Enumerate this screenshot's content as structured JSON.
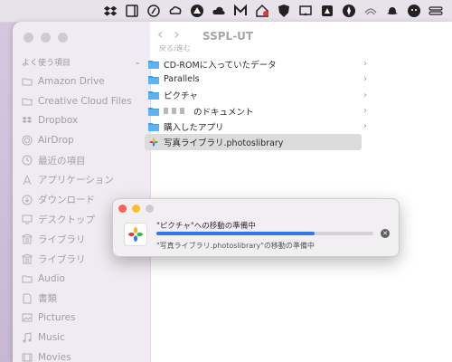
{
  "window": {
    "title": "SSPL-UT",
    "nav_label": "戻る/進む"
  },
  "sidebar": {
    "section_title": "よく使う項目",
    "items": [
      {
        "label": "Amazon Drive",
        "icon": "folder-icon"
      },
      {
        "label": "Creative Cloud Files",
        "icon": "folder-icon"
      },
      {
        "label": "Dropbox",
        "icon": "dropbox-icon"
      },
      {
        "label": "AirDrop",
        "icon": "airdrop-icon"
      },
      {
        "label": "最近の項目",
        "icon": "clock-icon"
      },
      {
        "label": "アプリケーション",
        "icon": "applications-icon"
      },
      {
        "label": "ダウンロード",
        "icon": "download-icon"
      },
      {
        "label": "デスクトップ",
        "icon": "desktop-icon"
      },
      {
        "label": "ライブラリ",
        "icon": "library-icon"
      },
      {
        "label": "ライブラリ",
        "icon": "library-icon"
      },
      {
        "label": "Audio",
        "icon": "folder-icon"
      },
      {
        "label": "書類",
        "icon": "document-icon"
      },
      {
        "label": "Pictures",
        "icon": "pictures-icon"
      },
      {
        "label": "Music",
        "icon": "music-icon"
      },
      {
        "label": "Movies",
        "icon": "movies-icon"
      }
    ]
  },
  "files": [
    {
      "name": "CD-ROMに入っていたデータ",
      "type": "folder"
    },
    {
      "name": "Parallels",
      "type": "folder"
    },
    {
      "name": "ピクチャ",
      "type": "folder"
    },
    {
      "name": "のドキュメント",
      "type": "folder"
    },
    {
      "name": "購入したアプリ",
      "type": "folder"
    },
    {
      "name": "写真ライブラリ.photoslibrary",
      "type": "photoslibrary"
    }
  ],
  "dialog": {
    "title": "\"ピクチャ\"への移動の準備中",
    "subtitle": "\"写真ライブラリ.photoslibrary\"の移動の準備中",
    "progress": 0.73
  },
  "colors": {
    "accent": "#2f7ae5",
    "close": "#fe5f57",
    "minimize": "#febc2e"
  }
}
